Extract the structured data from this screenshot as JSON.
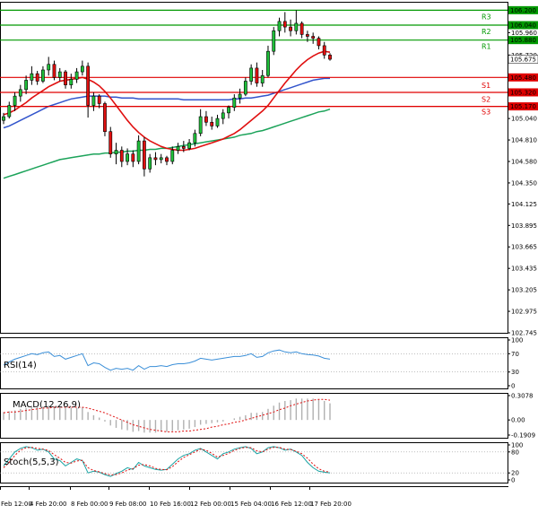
{
  "chart_data": {
    "type": "candlestick",
    "instrument_note": "",
    "price_axis": {
      "ticks": [
        106.2,
        106.04,
        105.96,
        105.88,
        105.72,
        105.675,
        105.48,
        105.32,
        105.17,
        105.04,
        104.81,
        104.58,
        104.35,
        104.125,
        103.895,
        103.665,
        103.435,
        103.205,
        102.975,
        102.745
      ],
      "ylim": [
        102.745,
        106.29
      ]
    },
    "time_axis": {
      "labels": [
        "Feb 12:00",
        "4 Feb 20:00",
        "8 Feb 00:00",
        "9 Feb 08:00",
        "10 Feb 16:00",
        "12 Feb 00:00",
        "15 Feb 04:00",
        "16 Feb 12:00",
        "17 Feb 20:00"
      ]
    },
    "current_price": "105.675",
    "levels": [
      {
        "label": "R3",
        "value": 106.2,
        "value_text": "106.200",
        "color": "#009900"
      },
      {
        "label": "R2",
        "value": 106.04,
        "value_text": "106.040",
        "color": "#009900"
      },
      {
        "label": "R1",
        "value": 105.88,
        "value_text": "105.880",
        "color": "#009900"
      },
      {
        "label": "",
        "value": 105.48,
        "value_text": "105.480",
        "color": "#e00000"
      },
      {
        "label": "S1",
        "value": 105.32,
        "value_text": "105.320",
        "color": "#e00000"
      },
      {
        "label": "S2",
        "value": 105.17,
        "value_text": "105.170",
        "color": "#e00000"
      },
      {
        "label": "S3",
        "value": 105.17,
        "value_text": "105.170",
        "color": "#e00000",
        "hide_tag": true
      }
    ],
    "candles": [
      [
        105.02,
        105.1,
        104.98,
        105.06
      ],
      [
        105.06,
        105.22,
        105.04,
        105.18
      ],
      [
        105.18,
        105.32,
        105.12,
        105.28
      ],
      [
        105.28,
        105.4,
        105.22,
        105.35
      ],
      [
        105.35,
        105.5,
        105.3,
        105.45
      ],
      [
        105.45,
        105.6,
        105.4,
        105.52
      ],
      [
        105.52,
        105.55,
        105.4,
        105.44
      ],
      [
        105.44,
        105.6,
        105.42,
        105.56
      ],
      [
        105.56,
        105.7,
        105.5,
        105.62
      ],
      [
        105.62,
        105.66,
        105.45,
        105.48
      ],
      [
        105.48,
        105.58,
        105.44,
        105.54
      ],
      [
        105.54,
        105.56,
        105.36,
        105.4
      ],
      [
        105.4,
        105.52,
        105.36,
        105.46
      ],
      [
        105.46,
        105.58,
        105.42,
        105.54
      ],
      [
        105.54,
        105.66,
        105.5,
        105.6
      ],
      [
        105.6,
        105.64,
        105.05,
        105.18
      ],
      [
        105.18,
        105.32,
        105.12,
        105.28
      ],
      [
        105.28,
        105.3,
        105.15,
        105.2
      ],
      [
        105.2,
        105.22,
        104.85,
        104.9
      ],
      [
        104.9,
        104.95,
        104.62,
        104.66
      ],
      [
        104.66,
        104.78,
        104.55,
        104.7
      ],
      [
        104.7,
        104.74,
        104.52,
        104.58
      ],
      [
        104.58,
        104.72,
        104.54,
        104.66
      ],
      [
        104.66,
        104.7,
        104.52,
        104.58
      ],
      [
        104.58,
        104.86,
        104.55,
        104.8
      ],
      [
        104.8,
        104.84,
        104.42,
        104.5
      ],
      [
        104.5,
        104.66,
        104.46,
        104.62
      ],
      [
        104.62,
        104.68,
        104.54,
        104.6
      ],
      [
        104.6,
        104.66,
        104.56,
        104.62
      ],
      [
        104.62,
        104.64,
        104.54,
        104.58
      ],
      [
        104.58,
        104.74,
        104.55,
        104.7
      ],
      [
        104.7,
        104.78,
        104.66,
        104.74
      ],
      [
        104.74,
        104.8,
        104.68,
        104.72
      ],
      [
        104.72,
        104.82,
        104.7,
        104.78
      ],
      [
        104.78,
        104.92,
        104.74,
        104.88
      ],
      [
        104.88,
        105.14,
        104.85,
        105.06
      ],
      [
        105.06,
        105.12,
        104.96,
        105.0
      ],
      [
        105.0,
        105.06,
        104.92,
        104.96
      ],
      [
        104.96,
        105.08,
        104.94,
        105.04
      ],
      [
        105.04,
        105.14,
        104.98,
        105.1
      ],
      [
        105.1,
        105.18,
        105.04,
        105.16
      ],
      [
        105.16,
        105.3,
        105.12,
        105.26
      ],
      [
        105.26,
        105.36,
        105.2,
        105.3
      ],
      [
        105.3,
        105.48,
        105.28,
        105.44
      ],
      [
        105.44,
        105.62,
        105.4,
        105.58
      ],
      [
        105.58,
        105.64,
        105.38,
        105.42
      ],
      [
        105.42,
        105.56,
        105.38,
        105.5
      ],
      [
        105.5,
        105.82,
        105.48,
        105.76
      ],
      [
        105.76,
        106.02,
        105.72,
        105.98
      ],
      [
        105.98,
        106.12,
        105.92,
        106.08
      ],
      [
        106.08,
        106.18,
        105.96,
        106.02
      ],
      [
        106.02,
        106.1,
        105.92,
        105.98
      ],
      [
        105.98,
        106.2,
        105.94,
        106.06
      ],
      [
        106.06,
        106.08,
        105.9,
        105.94
      ],
      [
        105.94,
        105.98,
        105.86,
        105.92
      ],
      [
        105.92,
        105.96,
        105.84,
        105.9
      ],
      [
        105.9,
        105.92,
        105.78,
        105.82
      ],
      [
        105.82,
        105.86,
        105.68,
        105.72
      ],
      [
        105.72,
        105.74,
        105.66,
        105.675
      ]
    ],
    "ma_fast": [
      105.08,
      105.1,
      105.13,
      105.17,
      105.21,
      105.26,
      105.3,
      105.34,
      105.38,
      105.41,
      105.44,
      105.45,
      105.46,
      105.47,
      105.48,
      105.46,
      105.43,
      105.39,
      105.33,
      105.26,
      105.18,
      105.1,
      105.02,
      104.95,
      104.89,
      104.84,
      104.8,
      104.77,
      104.74,
      104.72,
      104.71,
      104.7,
      104.7,
      104.71,
      104.72,
      104.74,
      104.76,
      104.78,
      104.8,
      104.82,
      104.85,
      104.88,
      104.92,
      104.97,
      105.02,
      105.07,
      105.12,
      105.18,
      105.26,
      105.34,
      105.42,
      105.49,
      105.56,
      105.62,
      105.67,
      105.71,
      105.74,
      105.76,
      105.75
    ],
    "ma_mid": [
      104.94,
      104.96,
      104.99,
      105.02,
      105.05,
      105.08,
      105.11,
      105.14,
      105.17,
      105.19,
      105.21,
      105.23,
      105.25,
      105.26,
      105.27,
      105.28,
      105.28,
      105.28,
      105.28,
      105.27,
      105.27,
      105.26,
      105.26,
      105.26,
      105.25,
      105.25,
      105.25,
      105.25,
      105.25,
      105.25,
      105.25,
      105.25,
      105.24,
      105.24,
      105.24,
      105.24,
      105.24,
      105.24,
      105.24,
      105.24,
      105.24,
      105.25,
      105.25,
      105.26,
      105.26,
      105.27,
      105.28,
      105.29,
      105.31,
      105.33,
      105.35,
      105.37,
      105.39,
      105.41,
      105.43,
      105.45,
      105.46,
      105.47,
      105.47
    ],
    "ma_slow": [
      104.4,
      104.42,
      104.44,
      104.46,
      104.48,
      104.5,
      104.52,
      104.54,
      104.56,
      104.58,
      104.6,
      104.61,
      104.62,
      104.63,
      104.64,
      104.65,
      104.66,
      104.66,
      104.67,
      104.67,
      104.68,
      104.68,
      104.69,
      104.69,
      104.7,
      104.7,
      104.71,
      104.71,
      104.72,
      104.72,
      104.73,
      104.74,
      104.75,
      104.76,
      104.77,
      104.78,
      104.79,
      104.8,
      104.81,
      104.82,
      104.83,
      104.84,
      104.86,
      104.87,
      104.88,
      104.9,
      104.91,
      104.93,
      104.95,
      104.97,
      104.99,
      105.01,
      105.03,
      105.05,
      105.07,
      105.09,
      105.11,
      105.12,
      105.14
    ],
    "rsi": {
      "name": "RSI(14)",
      "ticks": [
        100,
        70,
        30,
        0
      ],
      "ylim": [
        0,
        100
      ],
      "values": [
        45,
        52,
        58,
        62,
        66,
        70,
        68,
        72,
        74,
        64,
        66,
        58,
        62,
        66,
        70,
        44,
        50,
        48,
        40,
        34,
        38,
        36,
        38,
        34,
        44,
        36,
        42,
        42,
        44,
        42,
        46,
        48,
        48,
        50,
        54,
        60,
        58,
        56,
        58,
        60,
        62,
        64,
        64,
        66,
        70,
        62,
        64,
        72,
        76,
        78,
        74,
        72,
        74,
        70,
        68,
        67,
        65,
        60,
        58
      ]
    },
    "macd": {
      "name": "MACD(12,26,9)",
      "ticks": [
        0.3078,
        0.0,
        -0.1909
      ],
      "ylim": [
        -0.1909,
        0.3078
      ],
      "histogram": [
        0.1,
        0.11,
        0.12,
        0.14,
        0.15,
        0.16,
        0.16,
        0.17,
        0.18,
        0.17,
        0.17,
        0.15,
        0.15,
        0.15,
        0.16,
        0.1,
        0.06,
        0.03,
        -0.02,
        -0.07,
        -0.1,
        -0.12,
        -0.13,
        -0.15,
        -0.14,
        -0.16,
        -0.16,
        -0.16,
        -0.15,
        -0.15,
        -0.14,
        -0.13,
        -0.12,
        -0.11,
        -0.09,
        -0.06,
        -0.05,
        -0.04,
        -0.03,
        -0.02,
        0.0,
        0.02,
        0.04,
        0.06,
        0.09,
        0.09,
        0.1,
        0.14,
        0.18,
        0.22,
        0.24,
        0.25,
        0.27,
        0.27,
        0.27,
        0.27,
        0.26,
        0.24,
        0.21
      ],
      "signal": [
        0.09,
        0.1,
        0.1,
        0.11,
        0.12,
        0.13,
        0.14,
        0.15,
        0.15,
        0.16,
        0.16,
        0.16,
        0.16,
        0.16,
        0.16,
        0.15,
        0.13,
        0.11,
        0.09,
        0.06,
        0.03,
        0.0,
        -0.03,
        -0.06,
        -0.08,
        -0.1,
        -0.12,
        -0.13,
        -0.14,
        -0.15,
        -0.15,
        -0.15,
        -0.14,
        -0.14,
        -0.13,
        -0.12,
        -0.11,
        -0.09,
        -0.08,
        -0.06,
        -0.05,
        -0.03,
        -0.02,
        0.0,
        0.02,
        0.04,
        0.06,
        0.08,
        0.1,
        0.13,
        0.15,
        0.18,
        0.2,
        0.22,
        0.24,
        0.25,
        0.26,
        0.26,
        0.25
      ]
    },
    "stoch": {
      "name": "Stoch(5,5,3)",
      "ticks": [
        100,
        80,
        20,
        0
      ],
      "ylim": [
        0,
        100
      ],
      "k": [
        40,
        60,
        80,
        90,
        95,
        92,
        85,
        88,
        80,
        60,
        55,
        40,
        50,
        60,
        55,
        20,
        25,
        22,
        15,
        10,
        18,
        25,
        35,
        30,
        50,
        40,
        35,
        30,
        28,
        30,
        45,
        60,
        70,
        75,
        85,
        90,
        80,
        70,
        60,
        75,
        80,
        88,
        92,
        95,
        90,
        75,
        80,
        92,
        95,
        92,
        85,
        88,
        80,
        70,
        50,
        35,
        25,
        22,
        20
      ],
      "d": [
        35,
        50,
        70,
        85,
        92,
        93,
        90,
        88,
        84,
        72,
        62,
        50,
        48,
        54,
        56,
        35,
        27,
        23,
        18,
        14,
        15,
        20,
        28,
        32,
        42,
        44,
        40,
        33,
        30,
        29,
        38,
        52,
        64,
        72,
        80,
        88,
        85,
        76,
        65,
        70,
        76,
        84,
        90,
        93,
        92,
        83,
        80,
        88,
        93,
        93,
        88,
        87,
        82,
        75,
        62,
        45,
        32,
        25,
        22
      ]
    }
  }
}
